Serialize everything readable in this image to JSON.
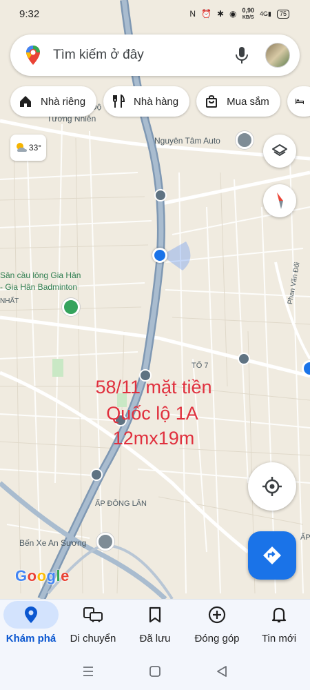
{
  "status_bar": {
    "time": "9:32",
    "speed_value": "0,90",
    "speed_unit": "KB/S",
    "network": "4G",
    "battery": "75"
  },
  "search": {
    "placeholder": "Tìm kiếm ở đây"
  },
  "chips": [
    {
      "label": "Nhà riêng",
      "icon": "home-icon"
    },
    {
      "label": "Nhà hàng",
      "icon": "restaurant-icon"
    },
    {
      "label": "Mua sắm",
      "icon": "shopping-bag-icon"
    },
    {
      "label": "",
      "icon": "hotel-bed-icon"
    }
  ],
  "weather": {
    "temp": "33°",
    "icon": "partly-cloudy-icon"
  },
  "map_labels": {
    "tuong_nhien_partial": "Tường Nhiên",
    "do_partial": "Độ",
    "nguyen_tam_auto": "Nguyên Tâm Auto",
    "badminton_1": "Sân cầu lông Gia Hân",
    "badminton_2": "- Gia Hân Badminton",
    "nhat_partial": "NHẤT",
    "to_7": "TỔ 7",
    "phan_van_doi": "Phan Văn Đối",
    "ap_dong_lan": "ẤP ĐÔNG LÂN",
    "ben_xe": "Bến Xe An Sương",
    "ap_partial": "ẤP"
  },
  "overlay": {
    "line1": "58/11 mặt tiền",
    "line2": "Quốc lộ 1A",
    "line3": "12mx19m"
  },
  "logo": "Google",
  "bottom_nav": [
    {
      "label": "Khám phá",
      "icon": "explore-pin-icon",
      "active": true
    },
    {
      "label": "Di chuyển",
      "icon": "commute-icon",
      "active": false
    },
    {
      "label": "Đã lưu",
      "icon": "bookmark-icon",
      "active": false
    },
    {
      "label": "Đóng góp",
      "icon": "add-circle-icon",
      "active": false
    },
    {
      "label": "Tin mới",
      "icon": "bell-icon",
      "active": false
    }
  ],
  "colors": {
    "accent": "#1a73e8",
    "overlay_text": "#e0303e",
    "highway": "#8aa0b8",
    "map_bg": "#f0ebe0"
  }
}
